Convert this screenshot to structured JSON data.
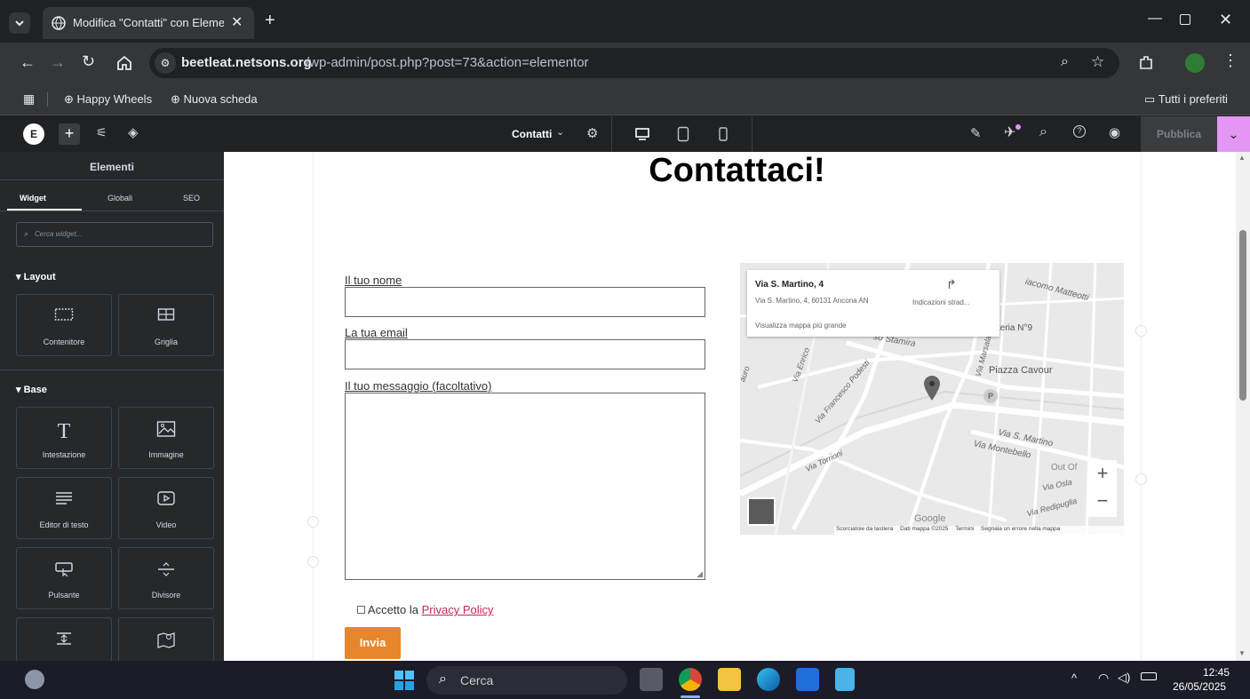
{
  "browser": {
    "tab_title": "Modifica \"Contatti\" con Elemen",
    "url_domain": "beetleat.netsons.org",
    "url_path": "/wp-admin/post.php?post=73&action=elementor",
    "bookmarks": [
      "Happy Wheels",
      "Nuova scheda"
    ],
    "all_bookmarks": "Tutti i preferiti"
  },
  "editor": {
    "page_name": "Contatti",
    "publish_label": "Pubblica"
  },
  "sidebar": {
    "title": "Elementi",
    "tabs": [
      "Widget",
      "Globali",
      "SEO"
    ],
    "search_placeholder": "Cerca widget...",
    "section_layout": "Layout",
    "section_base": "Base",
    "widgets": {
      "container": "Contenitore",
      "grid": "Griglia",
      "heading": "Intestazione",
      "image": "Immagine",
      "text_editor": "Editor di testo",
      "video": "Video",
      "button": "Pulsante",
      "divider": "Divisore"
    }
  },
  "page": {
    "heading": "Contattaci!",
    "form": {
      "name_label": "Il tuo nome",
      "email_label": "La tua email",
      "message_label": "Il tuo messaggio (facoltativo)",
      "accept_prefix": "Accetto la",
      "privacy_link": "Privacy Policy",
      "submit_label": "Invia"
    },
    "map": {
      "place_title": "Via S. Martino, 4",
      "place_address": "Via S. Martino, 4, 60131 Ancona AN",
      "directions": "Indicazioni strad...",
      "view_larger": "Visualizza mappa più grande",
      "streets": [
        "iacomo Matteotti",
        "teria N°9",
        "so Stamira",
        "Piazza Cavour",
        "Via Marsala",
        "Via Francesco Podesti",
        "Via Enrico",
        "Via S. Martino",
        "Via Montebello",
        "Via Torrioni",
        "Out Of",
        "Via Osla",
        "Via Redipuglia",
        "auro"
      ],
      "footer": [
        "Scorciatoie da tastiera",
        "Dati mappa ©2025",
        "Termini",
        "Segnala un errore nella mappa"
      ],
      "logo": "Google"
    }
  },
  "taskbar": {
    "search_label": "Cerca",
    "time": "12:45",
    "date": "26/05/2025"
  },
  "colors": {
    "accent_submit": "#e8862b",
    "elementor_pink": "#e396f5",
    "link": "#c5255d"
  }
}
